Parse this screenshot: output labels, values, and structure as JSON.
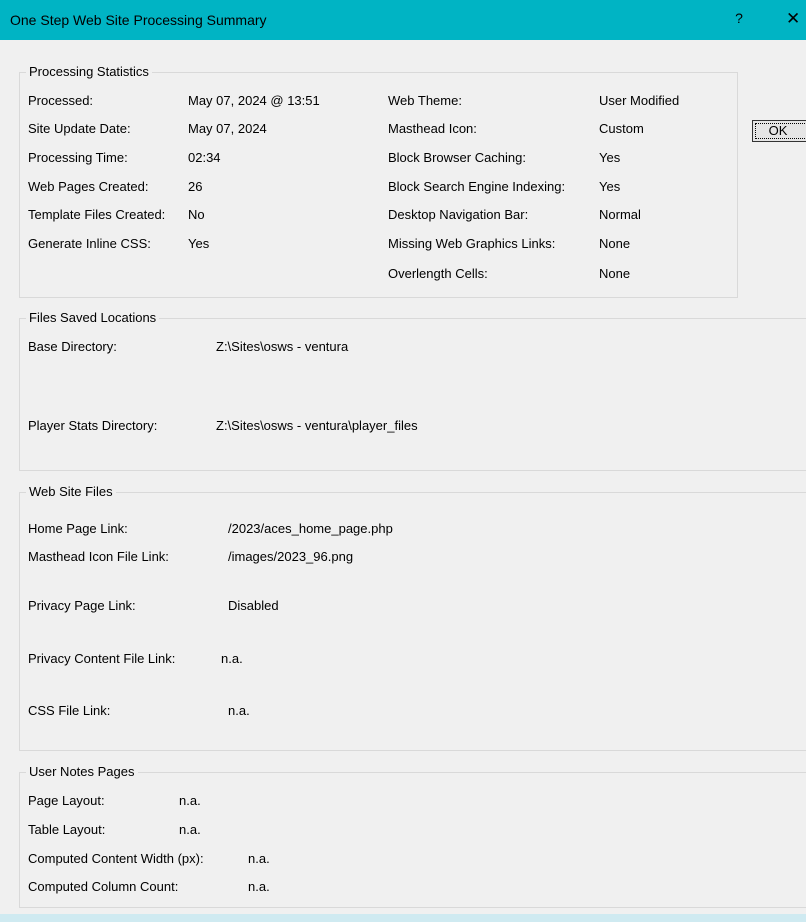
{
  "window": {
    "title": "One Step Web Site Processing Summary",
    "help_label": "?",
    "close_label": "✕",
    "ok_label": "OK"
  },
  "processing_statistics": {
    "title": "Processing Statistics",
    "left": [
      {
        "label": "Processed:",
        "value": "May 07, 2024 @ 13:51"
      },
      {
        "label": "Site Update Date:",
        "value": "May 07, 2024"
      },
      {
        "label": "Processing Time:",
        "value": "02:34"
      },
      {
        "label": "Web Pages Created:",
        "value": "26"
      },
      {
        "label": "Template Files Created:",
        "value": "No"
      },
      {
        "label": "Generate Inline CSS:",
        "value": "Yes"
      }
    ],
    "right": [
      {
        "label": "Web Theme:",
        "value": "User Modified"
      },
      {
        "label": "Masthead Icon:",
        "value": "Custom"
      },
      {
        "label": "Block Browser Caching:",
        "value": "Yes"
      },
      {
        "label": "Block Search Engine Indexing:",
        "value": "Yes"
      },
      {
        "label": "Desktop Navigation Bar:",
        "value": "Normal"
      },
      {
        "label": "Missing Web Graphics Links:",
        "value": "None"
      },
      {
        "label": "Overlength Cells:",
        "value": "None"
      }
    ]
  },
  "files_saved_locations": {
    "title": "Files Saved Locations",
    "rows": [
      {
        "label": "Base Directory:",
        "value": "Z:\\Sites\\osws - ventura"
      },
      {
        "label": "Player Stats Directory:",
        "value": "Z:\\Sites\\osws - ventura\\player_files"
      }
    ]
  },
  "web_site_files": {
    "title": "Web Site Files",
    "rows": [
      {
        "label": "Home Page Link:",
        "value": "/2023/aces_home_page.php"
      },
      {
        "label": "Masthead Icon File Link:",
        "value": "/images/2023_96.png"
      },
      {
        "label": "Privacy Page Link:",
        "value": "Disabled"
      },
      {
        "label": "Privacy Content File Link:",
        "value": "n.a."
      },
      {
        "label": "CSS File Link:",
        "value": "n.a."
      }
    ]
  },
  "user_notes_pages": {
    "title": "User Notes Pages",
    "rows": [
      {
        "label": "Page Layout:",
        "value": "n.a."
      },
      {
        "label": "Table Layout:",
        "value": "n.a."
      },
      {
        "label": "Computed Content Width (px):",
        "value": "n.a."
      },
      {
        "label": "Computed Column Count:",
        "value": "n.a."
      }
    ]
  }
}
